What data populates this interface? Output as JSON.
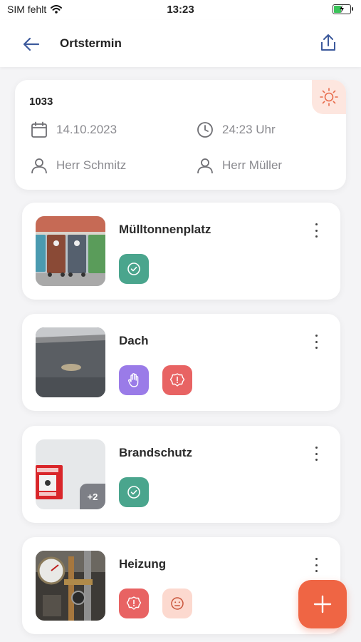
{
  "status_bar": {
    "carrier": "SIM fehlt",
    "time": "13:23"
  },
  "header": {
    "title": "Ortstermin"
  },
  "appointment": {
    "id": "1033",
    "date": "14.10.2023",
    "time": "24:23 Uhr",
    "person_left": "Herr Schmitz",
    "person_right": "Herr Müller"
  },
  "items": [
    {
      "title": "Mülltonnenplatz",
      "badges": [
        "check"
      ]
    },
    {
      "title": "Dach",
      "badges": [
        "hand",
        "alert"
      ]
    },
    {
      "title": "Brandschutz",
      "badges": [
        "check"
      ],
      "extra_images": "+2"
    },
    {
      "title": "Heizung",
      "badges": [
        "alert",
        "neutral-face"
      ]
    }
  ],
  "colors": {
    "accent": "#ef6544",
    "check_badge": "#4aa58d",
    "hand_badge": "#9a7be8",
    "alert_badge": "#e86363",
    "neutral_badge": "#fcd9cf"
  }
}
